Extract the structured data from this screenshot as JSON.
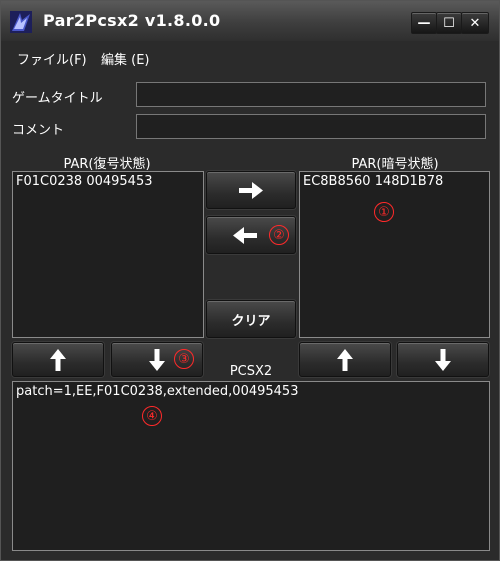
{
  "window": {
    "title": "Par2Pcsx2 v1.8.0.0",
    "minimize": "—",
    "maximize": "☐",
    "close": "✕"
  },
  "menu": [
    {
      "label": "ファイル(F)"
    },
    {
      "label": "編集 (E)"
    }
  ],
  "form": {
    "game_title_label": "ゲームタイトル",
    "comment_label": "コメント",
    "game_title_value": "",
    "comment_value": ""
  },
  "par_decoded": {
    "label": "PAR(復号状態)",
    "content": "F01C0238 00495453"
  },
  "par_encoded": {
    "label": "PAR(暗号状態)",
    "content": "EC8B8560 148D1B78"
  },
  "buttons": {
    "clear": "クリア"
  },
  "pcsx2": {
    "label": "PCSX2",
    "content": "patch=1,EE,F01C0238,extended,00495453"
  },
  "markers": [
    "①",
    "②",
    "③",
    "④"
  ],
  "colors": {
    "background": "#2b2b2b",
    "marker": "#ff2a2a",
    "text": "#ffffff"
  }
}
